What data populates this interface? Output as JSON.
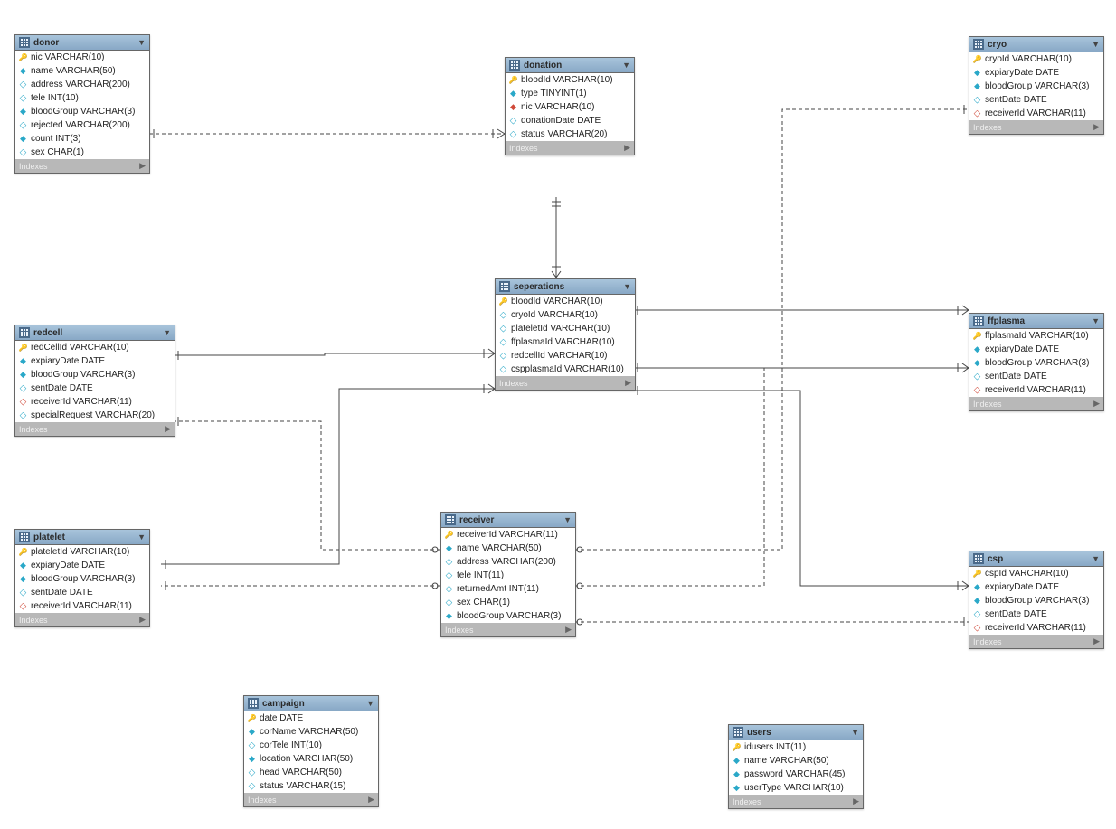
{
  "indexesLabel": "Indexes",
  "tables": {
    "donor": {
      "title": "donor",
      "cols": [
        {
          "icon": "key",
          "text": "nic VARCHAR(10)"
        },
        {
          "icon": "b",
          "text": "name VARCHAR(50)"
        },
        {
          "icon": "h",
          "text": "address VARCHAR(200)"
        },
        {
          "icon": "h",
          "text": "tele INT(10)"
        },
        {
          "icon": "b",
          "text": "bloodGroup VARCHAR(3)"
        },
        {
          "icon": "h",
          "text": "rejected VARCHAR(200)"
        },
        {
          "icon": "b",
          "text": "count INT(3)"
        },
        {
          "icon": "h",
          "text": "sex CHAR(1)"
        }
      ]
    },
    "donation": {
      "title": "donation",
      "cols": [
        {
          "icon": "key",
          "text": "bloodId VARCHAR(10)"
        },
        {
          "icon": "b",
          "text": "type TINYINT(1)"
        },
        {
          "icon": "r",
          "text": "nic VARCHAR(10)"
        },
        {
          "icon": "h",
          "text": "donationDate DATE"
        },
        {
          "icon": "h",
          "text": "status VARCHAR(20)"
        }
      ]
    },
    "cryo": {
      "title": "cryo",
      "cols": [
        {
          "icon": "key",
          "text": "cryoId VARCHAR(10)"
        },
        {
          "icon": "b",
          "text": "expiaryDate DATE"
        },
        {
          "icon": "b",
          "text": "bloodGroup VARCHAR(3)"
        },
        {
          "icon": "h",
          "text": "sentDate DATE"
        },
        {
          "icon": "p",
          "text": "receiverId VARCHAR(11)"
        }
      ]
    },
    "redcell": {
      "title": "redcell",
      "cols": [
        {
          "icon": "key",
          "text": "redCellId VARCHAR(10)"
        },
        {
          "icon": "b",
          "text": "expiaryDate DATE"
        },
        {
          "icon": "b",
          "text": "bloodGroup VARCHAR(3)"
        },
        {
          "icon": "h",
          "text": "sentDate DATE"
        },
        {
          "icon": "p",
          "text": "receiverId VARCHAR(11)"
        },
        {
          "icon": "h",
          "text": "specialRequest VARCHAR(20)"
        }
      ]
    },
    "seperations": {
      "title": "seperations",
      "cols": [
        {
          "icon": "key",
          "text": "bloodId VARCHAR(10)"
        },
        {
          "icon": "h",
          "text": "cryoId VARCHAR(10)"
        },
        {
          "icon": "h",
          "text": "plateletId VARCHAR(10)"
        },
        {
          "icon": "h",
          "text": "ffplasmaId VARCHAR(10)"
        },
        {
          "icon": "h",
          "text": "redcellId VARCHAR(10)"
        },
        {
          "icon": "h",
          "text": "cspplasmaId VARCHAR(10)"
        }
      ]
    },
    "ffplasma": {
      "title": "ffplasma",
      "cols": [
        {
          "icon": "key",
          "text": "ffplasmaId VARCHAR(10)"
        },
        {
          "icon": "b",
          "text": "expiaryDate DATE"
        },
        {
          "icon": "b",
          "text": "bloodGroup VARCHAR(3)"
        },
        {
          "icon": "h",
          "text": "sentDate DATE"
        },
        {
          "icon": "p",
          "text": "receiverId VARCHAR(11)"
        }
      ]
    },
    "platelet": {
      "title": "platelet",
      "cols": [
        {
          "icon": "key",
          "text": "plateletId VARCHAR(10)"
        },
        {
          "icon": "b",
          "text": "expiaryDate DATE"
        },
        {
          "icon": "b",
          "text": "bloodGroup VARCHAR(3)"
        },
        {
          "icon": "h",
          "text": "sentDate DATE"
        },
        {
          "icon": "p",
          "text": "receiverId VARCHAR(11)"
        }
      ]
    },
    "receiver": {
      "title": "receiver",
      "cols": [
        {
          "icon": "key",
          "text": "receiverId VARCHAR(11)"
        },
        {
          "icon": "b",
          "text": "name VARCHAR(50)"
        },
        {
          "icon": "h",
          "text": "address VARCHAR(200)"
        },
        {
          "icon": "h",
          "text": "tele INT(11)"
        },
        {
          "icon": "h",
          "text": "returnedAmt INT(11)"
        },
        {
          "icon": "h",
          "text": "sex CHAR(1)"
        },
        {
          "icon": "b",
          "text": "bloodGroup VARCHAR(3)"
        }
      ]
    },
    "csp": {
      "title": "csp",
      "cols": [
        {
          "icon": "key",
          "text": "cspId VARCHAR(10)"
        },
        {
          "icon": "b",
          "text": "expiaryDate DATE"
        },
        {
          "icon": "b",
          "text": "bloodGroup VARCHAR(3)"
        },
        {
          "icon": "h",
          "text": "sentDate DATE"
        },
        {
          "icon": "p",
          "text": "receiverId VARCHAR(11)"
        }
      ]
    },
    "campaign": {
      "title": "campaign",
      "cols": [
        {
          "icon": "key",
          "text": "date DATE"
        },
        {
          "icon": "b",
          "text": "corName VARCHAR(50)"
        },
        {
          "icon": "h",
          "text": "corTele INT(10)"
        },
        {
          "icon": "b",
          "text": "location VARCHAR(50)"
        },
        {
          "icon": "h",
          "text": "head VARCHAR(50)"
        },
        {
          "icon": "h",
          "text": "status VARCHAR(15)"
        }
      ]
    },
    "users": {
      "title": "users",
      "cols": [
        {
          "icon": "key",
          "text": "idusers INT(11)"
        },
        {
          "icon": "b",
          "text": "name VARCHAR(50)"
        },
        {
          "icon": "b",
          "text": "password VARCHAR(45)"
        },
        {
          "icon": "b",
          "text": "userType VARCHAR(10)"
        }
      ]
    }
  }
}
